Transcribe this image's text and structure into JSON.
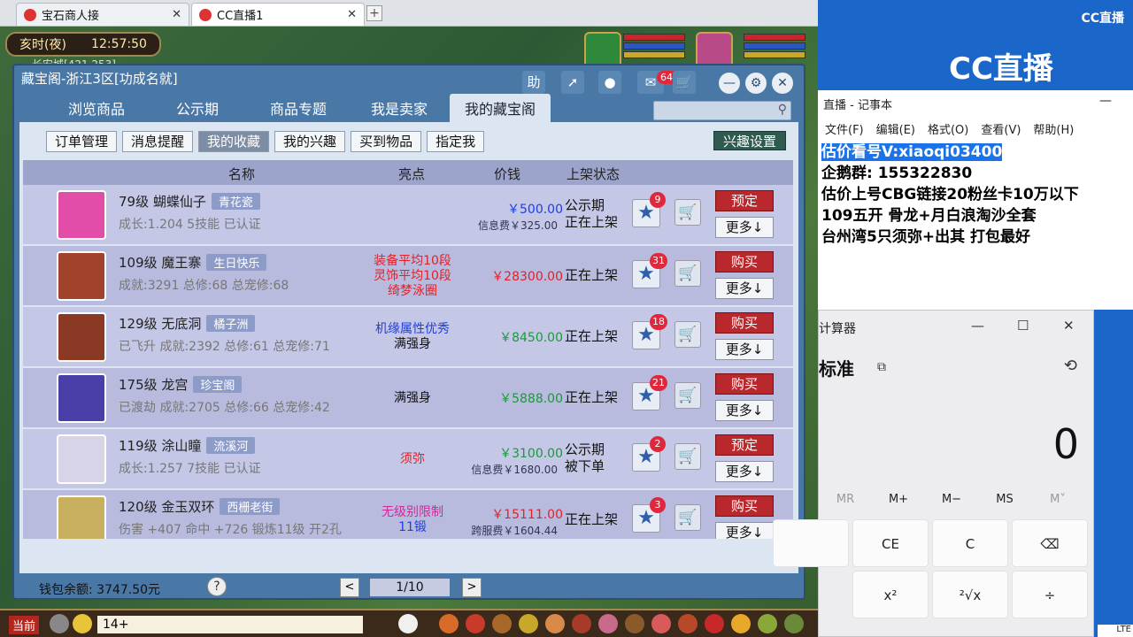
{
  "browser": {
    "tabs": [
      {
        "label": "宝石商人接"
      },
      {
        "label": "CC直播1"
      }
    ],
    "new_tab": "+",
    "close": "✕"
  },
  "game": {
    "time": "亥时(夜)",
    "clock": "12:57:50",
    "location": "长安城[421,253]",
    "current_channel": "当前",
    "chat_input": "14+"
  },
  "window": {
    "title": "藏宝阁-浙江3区[功成名就]",
    "help_label": "助",
    "badge": "641",
    "nav_tabs": [
      {
        "label": "浏览商品"
      },
      {
        "label": "公示期"
      },
      {
        "label": "商品专题"
      },
      {
        "label": "我是卖家"
      },
      {
        "label": "我的藏宝阁"
      }
    ],
    "sub_tabs": [
      {
        "label": "订单管理"
      },
      {
        "label": "消息提醒"
      },
      {
        "label": "我的收藏"
      },
      {
        "label": "我的兴趣"
      },
      {
        "label": "买到物品"
      },
      {
        "label": "指定我"
      }
    ],
    "interest_settings": "兴趣设置",
    "columns": {
      "name": "名称",
      "highlight": "亮点",
      "price": "价钱",
      "status": "上架状态"
    },
    "items": [
      {
        "name": "79级 蝴蝶仙子",
        "tag": "青花瓷",
        "desc": "成长:1.204 5技能 已认证",
        "highlight": [],
        "price": "￥500.00",
        "price_color": "#1d3fe0",
        "fee": "信息费￥325.00",
        "status": [
          "公示期",
          "正在上架"
        ],
        "count": "9",
        "action": "预定",
        "more": "更多↓",
        "avatar_color": "#e24da8"
      },
      {
        "name": "109级 魔王寨",
        "tag": "生日快乐",
        "desc": "成就:3291 总修:68 总宠修:68",
        "highlight": [
          {
            "text": "装备平均10段",
            "color": "#e0222a"
          },
          {
            "text": "灵饰平均10段",
            "color": "#e0222a"
          },
          {
            "text": "绮梦泳圈",
            "color": "#e0222a"
          }
        ],
        "price": "￥28300.00",
        "price_color": "#e0222a",
        "fee": "",
        "status": [
          "正在上架"
        ],
        "count": "31",
        "action": "购买",
        "more": "更多↓",
        "avatar_color": "#a0432a"
      },
      {
        "name": "129级 无底洞",
        "tag": "橘子洲",
        "desc": "已飞升 成就:2392 总修:61 总宠修:71",
        "highlight": [
          {
            "text": "机缘属性优秀",
            "color": "#1d3fe0"
          },
          {
            "text": "满强身",
            "color": "#111"
          }
        ],
        "price": "￥8450.00",
        "price_color": "#1a9a3a",
        "fee": "",
        "status": [
          "正在上架"
        ],
        "count": "18",
        "action": "购买",
        "more": "更多↓",
        "avatar_color": "#8a3a24"
      },
      {
        "name": "175级 龙宫",
        "tag": "珍宝阁",
        "desc": "已渡劫 成就:2705 总修:66 总宠修:42",
        "highlight": [
          {
            "text": "满强身",
            "color": "#111"
          }
        ],
        "price": "￥5888.00",
        "price_color": "#1a9a3a",
        "fee": "",
        "status": [
          "正在上架"
        ],
        "count": "21",
        "action": "购买",
        "more": "更多↓",
        "avatar_color": "#4a3fa8"
      },
      {
        "name": "119级 涂山瞳",
        "tag": "流溪河",
        "desc": "成长:1.257 7技能 已认证",
        "highlight": [
          {
            "text": "须弥",
            "color": "#e0222a"
          }
        ],
        "price": "￥3100.00",
        "price_color": "#1a9a3a",
        "fee": "信息费￥1680.00",
        "status": [
          "公示期",
          "被下单"
        ],
        "count": "2",
        "action": "预定",
        "more": "更多↓",
        "avatar_color": "#d8d4e8"
      },
      {
        "name": "120级 金玉双环",
        "tag": "西栅老街",
        "desc": "伤害 +407 命中 +726 锻炼11级 开2孔",
        "highlight": [
          {
            "text": "无级别限制",
            "color": "#d02a9a"
          },
          {
            "text": "11锻",
            "color": "#1d3fe0"
          }
        ],
        "price": "￥15111.00",
        "price_color": "#e0222a",
        "fee": "跨服费￥1604.44",
        "status": [
          "正在上架"
        ],
        "count": "3",
        "action": "购买",
        "more": "更多↓",
        "avatar_color": "#c8b060"
      }
    ],
    "wallet": "钱包余额: 3747.50元",
    "help": "?",
    "page": "1/10",
    "prev": "<",
    "next": ">"
  },
  "stream": {
    "logo_small": "CC直播",
    "logo_big": "CC直播"
  },
  "notepad": {
    "title": "直播 - 记事本",
    "menu": [
      "文件(F)",
      "编辑(E)",
      "格式(O)",
      "查看(V)",
      "帮助(H)"
    ],
    "lines": [
      "估价看号V:xiaoqi03400",
      "企鹅群: 155322830",
      "估价上号CBG链接20粉丝卡10万以下",
      "109五开 骨龙+月白浪淘沙全套",
      "台州湾5只须弥+出其 打包最好"
    ]
  },
  "calculator": {
    "title": "计算器",
    "mode": "标准",
    "display": "0",
    "memory": [
      "MR",
      "M+",
      "M−",
      "MS",
      "M˅"
    ],
    "keys": [
      "CE",
      "C",
      "⌫",
      "x²",
      "²√x",
      "÷"
    ]
  },
  "taskbar": {
    "lang": "LTE"
  }
}
